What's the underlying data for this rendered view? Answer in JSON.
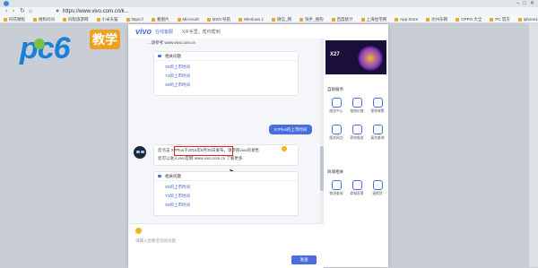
{
  "browser": {
    "url": "https://www.vivo.com.cn/k..."
  },
  "bookmarks": [
    "同花顺程",
    "搜狗问问",
    "同程旅游网",
    "小米天猫",
    "https://",
    "看图片",
    "Microsoft",
    "MSN 导航",
    "Windows 1",
    "微信_网",
    "快手_搜狗",
    "百度统计",
    "上海住宅网",
    "App Store",
    "达州乐网",
    "OPPO 大全",
    "PC 官方",
    "iphone11",
    "上海市 10c"
  ],
  "watermark": {
    "brand": "pc6",
    "tag": "教学"
  },
  "header": {
    "logo": "vivo",
    "title": "在线客服",
    "subtitle": "X/F手里，帮你帮到"
  },
  "chat": {
    "snippet": "...请参考 www.vivo.com.cn",
    "card1": {
      "title": "相关问题",
      "links": [
        "X5的上市时间",
        "Y3的上市时间",
        "X9的上市时间"
      ]
    },
    "user_message": "X7Plus的上市时间",
    "bot_message": {
      "line1": "您点击 X7Plus于2016年6月30日发布，请参照vivo的发售",
      "line2": "您可以进入vivo官网 www.vivo.com.cn 了解更多"
    },
    "card2": {
      "title": "相关问题",
      "links": [
        "X5的上市时间",
        "Y3的上市时间",
        "X9的上市时间"
      ]
    }
  },
  "composer": {
    "placeholder": "请输入您要咨询的问题",
    "send_label": "发送"
  },
  "sidebar": {
    "banner_text": "X27",
    "section1_title": "自助服务",
    "services1": [
      "服务中心",
      "维修价格",
      "保修政策",
      "服务网点",
      "寄修服务",
      "真伪查询"
    ],
    "section2_title": "商城相关",
    "services2": [
      "物流查询",
      "商城发票",
      "退换货"
    ]
  },
  "colors": {
    "accent": "#4a6de0",
    "highlight": "#e02020"
  }
}
